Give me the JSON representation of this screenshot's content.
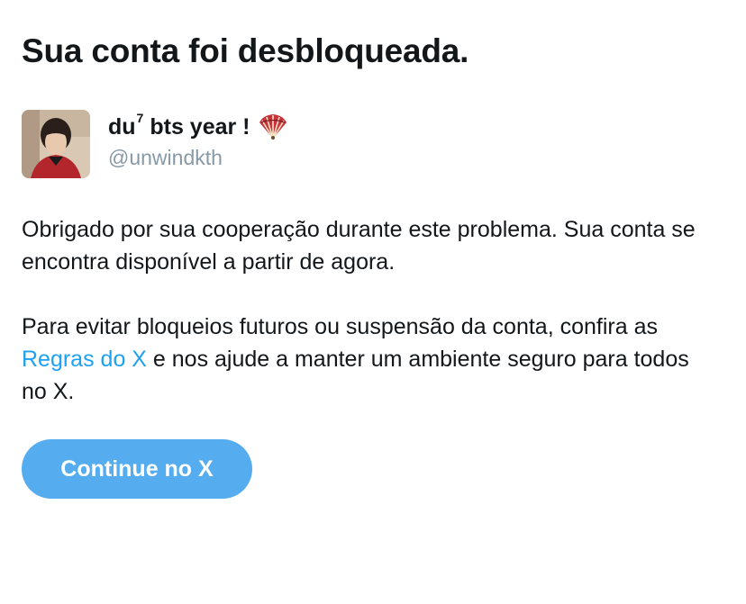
{
  "page": {
    "title": "Sua conta foi desbloqueada."
  },
  "profile": {
    "display_name": "du",
    "display_name_superscript": "7",
    "display_name_rest": "bts year !",
    "emoji_icon": "folding-fan-icon",
    "handle": "@unwindkth"
  },
  "message": {
    "paragraph1": "Obrigado por sua cooperação durante este problema. Sua conta se encontra disponível a partir de agora.",
    "paragraph2_before_link": "Para evitar bloqueios futuros ou suspensão da conta, confira as ",
    "link_text": "Regras do X",
    "paragraph2_after_link": " e nos ajude a manter um ambiente seguro para todos no X."
  },
  "actions": {
    "continue_label": "Continue no X"
  },
  "colors": {
    "text": "#14171a",
    "secondary_text": "#8899a6",
    "link": "#1da1f2",
    "button_bg": "#55acee",
    "button_text": "#ffffff"
  }
}
